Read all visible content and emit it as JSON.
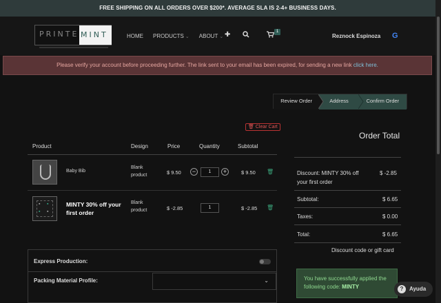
{
  "banner": "FREE SHIPPING ON ALL ORDERS OVER $200*. AVERAGE SLA IS 2-4+ BUSINESS DAYS.",
  "logo": {
    "part1": "PRINTED",
    "part2": "MINT"
  },
  "nav": {
    "home": "HOME",
    "products": "PRODUCTS",
    "about": "ABOUT",
    "plus_icon": "plus-icon",
    "search_icon": "search-icon",
    "cart_icon": "cart-icon",
    "cart_count": "1",
    "user": "Reznock Espinoza",
    "google_icon": "G"
  },
  "alert": {
    "text": "Please verify your account before proceeding further. The link sent to your email has been expired, for sending a new link ",
    "link": "click here."
  },
  "steps": [
    "Review Order",
    "Address",
    "Confirm Order"
  ],
  "cart": {
    "clear_label": "Clear Cart",
    "headers": {
      "product": "Product",
      "design": "Design",
      "price": "Price",
      "quantity": "Quantity",
      "subtotal": "Subtotal"
    },
    "items": [
      {
        "name": "Baby Bib",
        "design1": "Blank",
        "design2": "product",
        "price": "$ 9.50",
        "qty": "1",
        "subtotal": "$ 9.50"
      },
      {
        "name1": "MINTY 30% off your",
        "name2": "first order",
        "design1": "Blank",
        "design2": "product",
        "price": "$ -2.85",
        "qty": "1",
        "subtotal": "$ -2.85"
      }
    ],
    "minus": "−",
    "plus": "+"
  },
  "options": {
    "express_label": "Express Production:",
    "packing_label": "Packing Material Profile:"
  },
  "order": {
    "title": "Order Total",
    "discount_label1": "Discount: MINTY 30% off",
    "discount_label2": "your first order",
    "discount_value": "$ -2.85",
    "subtotal_label": "Subtotal:",
    "subtotal_value": "$ 6.65",
    "taxes_label": "Taxes:",
    "taxes_value": "$ 0.00",
    "total_label": "Total:",
    "total_value": "$ 6.65",
    "discount_link": "Discount code or gift card",
    "success1": "You have successfully applied the",
    "success2": "following code: ",
    "success_code": "MINTY"
  },
  "help": {
    "label": "Ayuda",
    "icon": "?"
  },
  "colors": {
    "accent": "#2f4a44",
    "banner": "#2f3b3b",
    "alert_bg": "#5a3436",
    "success_bg": "#2f4a34"
  }
}
